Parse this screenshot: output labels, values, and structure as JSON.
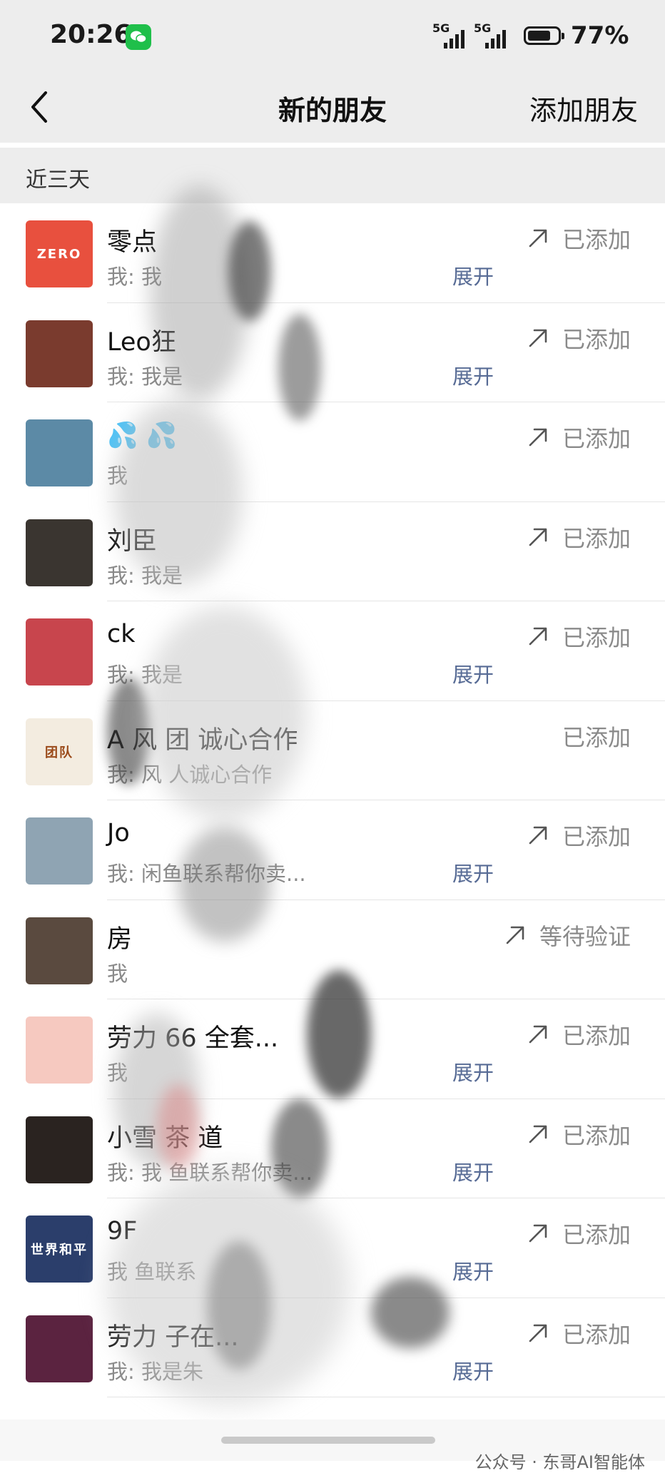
{
  "status_bar": {
    "time": "20:26",
    "battery": "77%",
    "battery_level": 0.77,
    "signal_labels": [
      "5G",
      "5G"
    ]
  },
  "nav": {
    "title": "新的朋友",
    "action": "添加朋友"
  },
  "section": {
    "label": "近三天"
  },
  "expand_label": "展开",
  "rows": [
    {
      "name": "零点",
      "message": "我: 我",
      "status": "已添加",
      "arrow": true,
      "expand": true,
      "avatar": {
        "bg": "#e8503e",
        "text": "ZERO"
      }
    },
    {
      "name": "Leo狂",
      "message": "我: 我是",
      "status": "已添加",
      "arrow": true,
      "expand": true,
      "avatar": {
        "bg": "#7a3b2e",
        "text": ""
      }
    },
    {
      "name": "💦 💦",
      "message": "我",
      "status": "已添加",
      "arrow": true,
      "expand": false,
      "avatar": {
        "bg": "#5c8aa6",
        "text": ""
      }
    },
    {
      "name": "刘臣",
      "message": "我: 我是",
      "status": "已添加",
      "arrow": true,
      "expand": false,
      "avatar": {
        "bg": "#3a3530",
        "text": ""
      }
    },
    {
      "name": "ck",
      "message": "我: 我是",
      "status": "已添加",
      "arrow": true,
      "expand": true,
      "avatar": {
        "bg": "#c8454d",
        "text": ""
      }
    },
    {
      "name": "A 风 团 诚心合作",
      "message": "我: 风 人诚心合作",
      "status": "已添加",
      "arrow": false,
      "expand": false,
      "avatar": {
        "bg": "#f3ece0",
        "text": "团队"
      }
    },
    {
      "name": "Jo",
      "message": "我: 闲鱼联系帮你卖...",
      "status": "已添加",
      "arrow": true,
      "expand": true,
      "avatar": {
        "bg": "#8fa4b3",
        "text": ""
      }
    },
    {
      "name": "房",
      "message": "我",
      "status": "等待验证",
      "arrow": true,
      "expand": false,
      "avatar": {
        "bg": "#5a4a3f",
        "text": ""
      }
    },
    {
      "name": "劳力 66 全套...",
      "message": "我",
      "status": "已添加",
      "arrow": true,
      "expand": true,
      "avatar": {
        "bg": "#f6c9c0",
        "text": ""
      }
    },
    {
      "name": "小雪 茶 道",
      "message": "我: 我 鱼联系帮你卖...",
      "status": "已添加",
      "arrow": true,
      "expand": true,
      "avatar": {
        "bg": "#2a2320",
        "text": ""
      }
    },
    {
      "name": "9F",
      "message": "我 鱼联系",
      "status": "已添加",
      "arrow": true,
      "expand": true,
      "avatar": {
        "bg": "#2b3e6b",
        "text": "世界和平"
      }
    },
    {
      "name": "劳力 子在...",
      "message": "我: 我是朱",
      "status": "已添加",
      "arrow": true,
      "expand": true,
      "avatar": {
        "bg": "#5b2340",
        "text": ""
      }
    }
  ],
  "watermark": "公众号 · 东哥AI智能体"
}
